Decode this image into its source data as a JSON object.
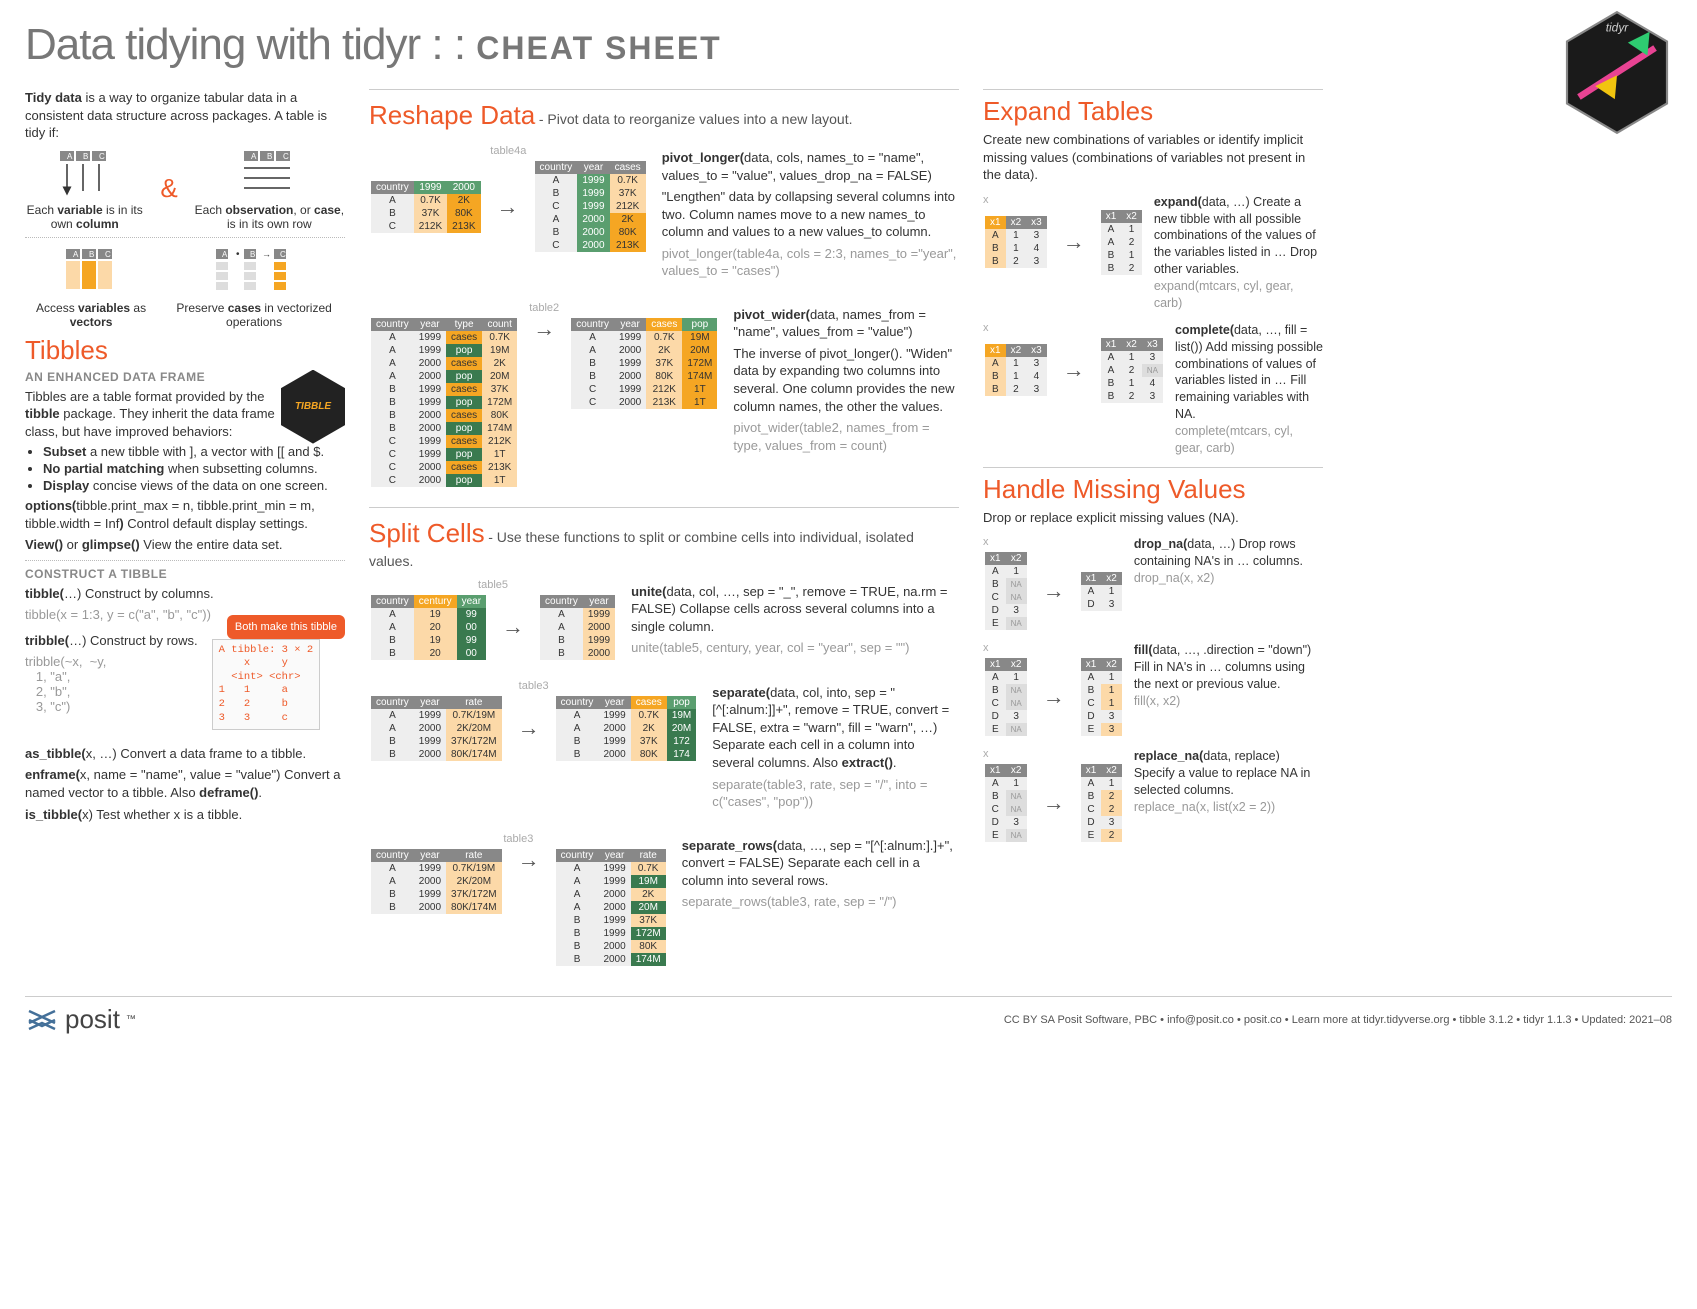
{
  "header": {
    "title_light": "Data tidying with tidyr : : ",
    "title_bold": "CHEAT SHEET"
  },
  "intro": {
    "p1_prefix": "Tidy data",
    "p1_rest": " is a way to organize tabular data in a consistent data structure across packages. A table is tidy if:",
    "cap1a": "Each ",
    "cap1b": "variable",
    "cap1c": " is in its own ",
    "cap1d": "column",
    "cap2a": "Each ",
    "cap2b": "observation",
    "cap2c": ", or ",
    "cap2d": "case",
    "cap2e": ", is in its own row",
    "cap3a": "Access ",
    "cap3b": "variables",
    "cap3c": " as ",
    "cap3d": "vectors",
    "cap4a": "Preserve ",
    "cap4b": "cases",
    "cap4c": " in vectorized operations"
  },
  "tibbles": {
    "heading": "Tibbles",
    "sub": "AN ENHANCED DATA FRAME",
    "p1": "Tibbles are a table format provided by the ",
    "p1b": "tibble",
    "p1c": " package. They inherit the data frame class, but have improved behaviors:",
    "b1a": "Subset",
    "b1b": " a new tibble with ], a vector with [[ and $.",
    "b2a": "No partial matching",
    "b2b": " when subsetting columns.",
    "b3a": "Display",
    "b3b": " concise views of the data on one screen.",
    "opt1": "options(",
    "opt2": "tibble.print_max = n, tibble.print_min = m, tibble.width = Inf",
    "opt3": ") ",
    "opt4": "Control default display settings.",
    "view": "View()",
    "view_or": " or ",
    "glimpse": "glimpse()",
    "view_rest": " View the entire data set.",
    "construct": "CONSTRUCT A TIBBLE",
    "tibble_f": "tibble(",
    "tibble_rest": "…) ",
    "tibble_desc": "Construct by columns.",
    "tibble_ex": "tibble(x = 1:3, y = c(\"a\", \"b\", \"c\"))",
    "tribble_f": "tribble(",
    "tribble_rest": "…) ",
    "tribble_desc": "Construct by rows.",
    "tribble_ex": "tribble(~x,  ~y,\n   1, \"a\",\n   2, \"b\",\n   3, \"c\")",
    "callout": "Both make this tibble",
    "tribble_out": "A tibble: 3 × 2\n    x     y\n  <int> <chr>\n1   1     a\n2   2     b\n3   3     c",
    "astibble": "as_tibble(",
    "astibble_rest": "x, …) ",
    "astibble_desc": "Convert a data frame to a tibble.",
    "enframe": "enframe(",
    "enframe_rest": "x, name = \"name\", value = \"value\") ",
    "enframe_desc": "Convert a named vector to a tibble. Also ",
    "deframe": "deframe()",
    "enframe_end": ".",
    "istibble": "is_tibble(",
    "istibble_rest": "x) ",
    "istibble_desc": "Test whether x is a tibble."
  },
  "reshape": {
    "heading": "Reshape Data",
    "sub": " - Pivot data to reorganize values into a new layout.",
    "t4a_label": "table4a",
    "t4a_head": [
      "country",
      "1999",
      "2000"
    ],
    "t4a_rows": [
      [
        "A",
        "0.7K",
        "2K"
      ],
      [
        "B",
        "37K",
        "80K"
      ],
      [
        "C",
        "212K",
        "213K"
      ]
    ],
    "t4a_out_head": [
      "country",
      "year",
      "cases"
    ],
    "t4a_out_rows": [
      [
        "A",
        "1999",
        "0.7K"
      ],
      [
        "B",
        "1999",
        "37K"
      ],
      [
        "C",
        "1999",
        "212K"
      ],
      [
        "A",
        "2000",
        "2K"
      ],
      [
        "B",
        "2000",
        "80K"
      ],
      [
        "C",
        "2000",
        "213K"
      ]
    ],
    "pl_sig": "pivot_longer(",
    "pl_args": "data, cols, names_to = \"name\", values_to = \"value\", values_drop_na = FALSE)",
    "pl_desc": "\"Lengthen\" data by collapsing several columns into two. Column names move to a new names_to column and values to a new values_to column.",
    "pl_ex": "pivot_longer(table4a, cols = 2:3, names_to =\"year\", values_to = \"cases\")",
    "t2_label": "table2",
    "t2_head": [
      "country",
      "year",
      "type",
      "count"
    ],
    "t2_rows": [
      [
        "A",
        "1999",
        "cases",
        "0.7K"
      ],
      [
        "A",
        "1999",
        "pop",
        "19M"
      ],
      [
        "A",
        "2000",
        "cases",
        "2K"
      ],
      [
        "A",
        "2000",
        "pop",
        "20M"
      ],
      [
        "B",
        "1999",
        "cases",
        "37K"
      ],
      [
        "B",
        "1999",
        "pop",
        "172M"
      ],
      [
        "B",
        "2000",
        "cases",
        "80K"
      ],
      [
        "B",
        "2000",
        "pop",
        "174M"
      ],
      [
        "C",
        "1999",
        "cases",
        "212K"
      ],
      [
        "C",
        "1999",
        "pop",
        "1T"
      ],
      [
        "C",
        "2000",
        "cases",
        "213K"
      ],
      [
        "C",
        "2000",
        "pop",
        "1T"
      ]
    ],
    "t2_out_head": [
      "country",
      "year",
      "cases",
      "pop"
    ],
    "t2_out_rows": [
      [
        "A",
        "1999",
        "0.7K",
        "19M"
      ],
      [
        "A",
        "2000",
        "2K",
        "20M"
      ],
      [
        "B",
        "1999",
        "37K",
        "172M"
      ],
      [
        "B",
        "2000",
        "80K",
        "174M"
      ],
      [
        "C",
        "1999",
        "212K",
        "1T"
      ],
      [
        "C",
        "2000",
        "213K",
        "1T"
      ]
    ],
    "pw_sig": "pivot_wider(",
    "pw_args": "data, names_from = \"name\", values_from = \"value\")",
    "pw_desc": "The inverse of pivot_longer(). \"Widen\" data by expanding two columns into several. One column provides the new column names, the other the values.",
    "pw_ex": "pivot_wider(table2, names_from = type, values_from = count)"
  },
  "split": {
    "heading": "Split Cells",
    "sub": " - Use these functions to split or combine cells into individual, isolated values.",
    "t5_label": "table5",
    "t5_head": [
      "country",
      "century",
      "year"
    ],
    "t5_rows": [
      [
        "A",
        "19",
        "99"
      ],
      [
        "A",
        "20",
        "00"
      ],
      [
        "B",
        "19",
        "99"
      ],
      [
        "B",
        "20",
        "00"
      ]
    ],
    "t5_out_head": [
      "country",
      "year"
    ],
    "t5_out_rows": [
      [
        "A",
        "1999"
      ],
      [
        "A",
        "2000"
      ],
      [
        "B",
        "1999"
      ],
      [
        "B",
        "2000"
      ]
    ],
    "unite_sig": "unite(",
    "unite_args": "data, col, …, sep = \"_\", remove = TRUE, na.rm = FALSE) ",
    "unite_desc": "Collapse cells across several columns into a single column.",
    "unite_ex": "unite(table5, century, year, col = \"year\", sep = \"\")",
    "t3_label": "table3",
    "t3_head": [
      "country",
      "year",
      "rate"
    ],
    "t3_rows": [
      [
        "A",
        "1999",
        "0.7K/19M"
      ],
      [
        "A",
        "2000",
        "2K/20M"
      ],
      [
        "B",
        "1999",
        "37K/172M"
      ],
      [
        "B",
        "2000",
        "80K/174M"
      ]
    ],
    "t3_out_head": [
      "country",
      "year",
      "cases",
      "pop"
    ],
    "t3_out_rows": [
      [
        "A",
        "1999",
        "0.7K",
        "19M"
      ],
      [
        "A",
        "2000",
        "2K",
        "20M"
      ],
      [
        "B",
        "1999",
        "37K",
        "172"
      ],
      [
        "B",
        "2000",
        "80K",
        "174"
      ]
    ],
    "sep_sig": "separate(",
    "sep_args": "data, col, into, sep = \"[^[:alnum:]]+\", remove = TRUE, convert = FALSE, extra = \"warn\", fill = \"warn\", …) ",
    "sep_desc": "Separate each cell in a column into several columns. Also ",
    "sep_extract": "extract()",
    "sep_end": ".",
    "sep_ex": "separate(table3, rate, sep = \"/\", into = c(\"cases\", \"pop\"))",
    "sr_out_head": [
      "country",
      "year",
      "rate"
    ],
    "sr_out_rows": [
      [
        "A",
        "1999",
        "0.7K"
      ],
      [
        "A",
        "1999",
        "19M"
      ],
      [
        "A",
        "2000",
        "2K"
      ],
      [
        "A",
        "2000",
        "20M"
      ],
      [
        "B",
        "1999",
        "37K"
      ],
      [
        "B",
        "1999",
        "172M"
      ],
      [
        "B",
        "2000",
        "80K"
      ],
      [
        "B",
        "2000",
        "174M"
      ]
    ],
    "sr_sig": "separate_rows(",
    "sr_args": "data, …, sep = \"[^[:alnum:].]+\", convert = FALSE) ",
    "sr_desc": "Separate each cell in a column into several rows.",
    "sr_ex": "separate_rows(table3, rate, sep = \"/\")"
  },
  "expand": {
    "heading": "Expand Tables",
    "intro": "Create new combinations of variables or identify implicit missing values (combinations of variables not present in the data).",
    "ex_sig": "expand(",
    "ex_args": "data, …) ",
    "ex_desc": "Create a new tibble with all possible combinations of the values of the variables listed in … Drop other variables.",
    "ex_ex": "expand(mtcars, cyl, gear, carb)",
    "cp_sig": "complete(",
    "cp_args": "data, …, fill = list()) ",
    "cp_desc": "Add missing possible combinations of values of variables listed in … Fill remaining variables with NA.",
    "cp_ex": "complete(mtcars, cyl, gear, carb)",
    "in_head": [
      "x1",
      "x2",
      "x3"
    ],
    "in_rows": [
      [
        "A",
        "1",
        "3"
      ],
      [
        "B",
        "1",
        "4"
      ],
      [
        "B",
        "2",
        "3"
      ]
    ],
    "ex_out_head": [
      "x1",
      "x2"
    ],
    "ex_out_rows": [
      [
        "A",
        "1"
      ],
      [
        "A",
        "2"
      ],
      [
        "B",
        "1"
      ],
      [
        "B",
        "2"
      ]
    ],
    "cp_out_head": [
      "x1",
      "x2",
      "x3"
    ],
    "cp_out_rows": [
      [
        "A",
        "1",
        "3"
      ],
      [
        "A",
        "2",
        "NA"
      ],
      [
        "B",
        "1",
        "4"
      ],
      [
        "B",
        "2",
        "3"
      ]
    ]
  },
  "missing": {
    "heading": "Handle Missing Values",
    "intro": "Drop or replace explicit missing values (NA).",
    "dn_sig": "drop_na(",
    "dn_args": "data, …) ",
    "dn_desc": "Drop rows containing NA's in … columns.",
    "dn_ex": "drop_na(x, x2)",
    "fl_sig": "fill(",
    "fl_args": "data, …, .direction = \"down\") ",
    "fl_desc": "Fill in NA's in … columns using the next or previous value.",
    "fl_ex": "fill(x, x2)",
    "rn_sig": "replace_na(",
    "rn_args": "data, replace) ",
    "rn_desc": "Specify a value to replace NA in selected columns.",
    "rn_ex": "replace_na(x, list(x2 = 2))",
    "x_label": "x",
    "x_head": [
      "x1",
      "x2"
    ],
    "x_rows": [
      [
        "A",
        "1"
      ],
      [
        "B",
        "NA"
      ],
      [
        "C",
        "NA"
      ],
      [
        "D",
        "3"
      ],
      [
        "E",
        "NA"
      ]
    ],
    "dn_out_rows": [
      [
        "A",
        "1"
      ],
      [
        "D",
        "3"
      ]
    ],
    "fl_out_rows": [
      [
        "A",
        "1"
      ],
      [
        "B",
        "1"
      ],
      [
        "C",
        "1"
      ],
      [
        "D",
        "3"
      ],
      [
        "E",
        "3"
      ]
    ],
    "rn_out_rows": [
      [
        "A",
        "1"
      ],
      [
        "B",
        "2"
      ],
      [
        "C",
        "2"
      ],
      [
        "D",
        "3"
      ],
      [
        "E",
        "2"
      ]
    ]
  },
  "footer": {
    "brand": "posit",
    "text": "CC BY SA Posit Software, PBC • info@posit.co • posit.co • Learn more at tidyr.tidyverse.org • tibble 3.1.2 • tidyr 1.1.3 • Updated: 2021–08"
  }
}
